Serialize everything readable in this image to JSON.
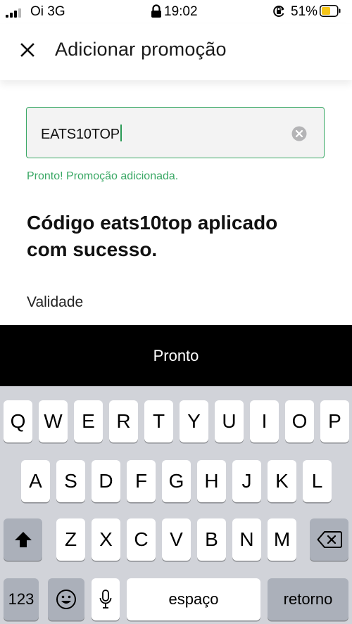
{
  "status_bar": {
    "carrier": "Oi 3G",
    "time": "19:02",
    "battery_percent": "51%",
    "signal_bars": 4,
    "signal_bars_active": 3,
    "battery_level": 0.51,
    "battery_color": "#f5c518"
  },
  "header": {
    "title": "Adicionar promoção",
    "close_icon": "close-icon"
  },
  "promo": {
    "input_value": "EATS10TOP",
    "clear_icon": "clear-circle-icon",
    "success_message": "Pronto! Promoção adicionada.",
    "applied_message": "Código eats10top aplicado com sucesso.",
    "validity_label": "Validade"
  },
  "done_bar": {
    "label": "Pronto"
  },
  "keyboard": {
    "row1": [
      "Q",
      "W",
      "E",
      "R",
      "T",
      "Y",
      "U",
      "I",
      "O",
      "P"
    ],
    "row2": [
      "A",
      "S",
      "D",
      "F",
      "G",
      "H",
      "J",
      "K",
      "L"
    ],
    "row3": [
      "Z",
      "X",
      "C",
      "V",
      "B",
      "N",
      "M"
    ],
    "shift_icon": "shift-arrow-icon",
    "delete_icon": "backspace-icon",
    "numbers_label": "123",
    "emoji_icon": "emoji-icon",
    "mic_icon": "microphone-icon",
    "space_label": "espaço",
    "return_label": "retorno"
  },
  "colors": {
    "accent_green": "#3aa865",
    "done_bar_bg": "#000000",
    "keyboard_bg": "#d1d3d9",
    "function_key_bg": "#abb0ba"
  }
}
